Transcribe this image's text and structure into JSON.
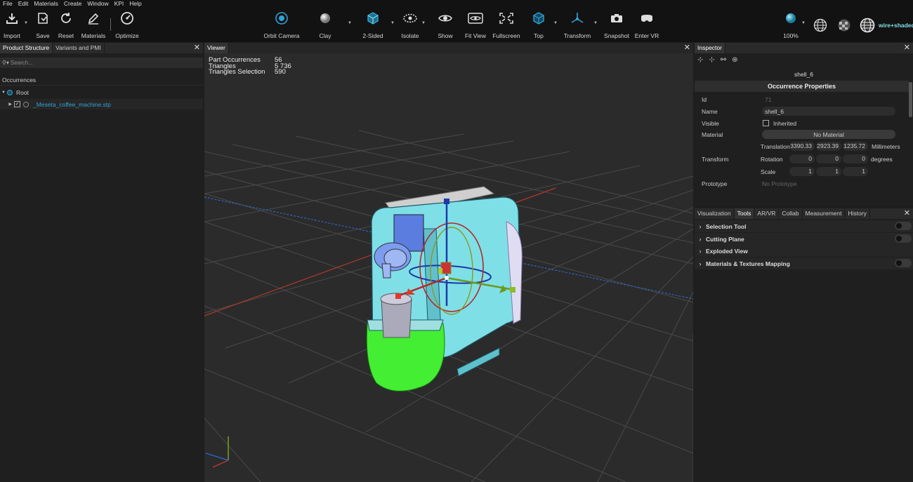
{
  "menu": [
    "File",
    "Edit",
    "Materials",
    "Create",
    "Window",
    "KPI",
    "Help"
  ],
  "toolbar": {
    "import": "Import",
    "save": "Save",
    "reset": "Reset",
    "materials": "Materials",
    "optimize": "Optimize",
    "orbit": "Orbit Camera",
    "clay": "Clay",
    "two_sided": "2-Sided",
    "isolate": "Isolate",
    "show": "Show",
    "fit_view": "Fit View",
    "fullscreen": "Fullscreen",
    "top": "Top",
    "transform": "Transform",
    "snapshot": "Snapshot",
    "enter_vr": "Enter VR",
    "zoom": "100%",
    "render_mode": "wire+shaded"
  },
  "left": {
    "tabs": [
      "Product Structure",
      "Variants and PMI"
    ],
    "search_placeholder": "Search...",
    "occurrences_header": "Occurrences",
    "tree": [
      {
        "label": "Root"
      },
      {
        "label": "_Meseta_coffee_machine.stp"
      }
    ]
  },
  "viewer": {
    "tab": "Viewer",
    "stats": [
      {
        "k": "Part Occurrences",
        "v": "56"
      },
      {
        "k": "Triangles",
        "v": "5 736"
      },
      {
        "k": "Triangles Selection",
        "v": "590"
      }
    ]
  },
  "inspector": {
    "tab": "Inspector",
    "selected": "shell_6",
    "section": "Occurrence Properties",
    "id_label": "Id",
    "id_value": "71",
    "name_label": "Name",
    "name_value": "shell_6",
    "visible_label": "Visible",
    "inherited": "Inherited",
    "material_label": "Material",
    "material_value": "No Material",
    "transform_label": "Transform",
    "translation_label": "Translation",
    "translation": [
      "3390.33",
      "2923.39",
      "1235.72"
    ],
    "translation_unit": "Millimeters",
    "rotation_label": "Rotation",
    "rotation": [
      "0",
      "0",
      "0"
    ],
    "rotation_unit": "degrees",
    "scale_label": "Scale",
    "scale": [
      "1",
      "1",
      "1"
    ],
    "prototype_label": "Prototype",
    "prototype_value": "No Prototype"
  },
  "tools": {
    "tabs": [
      "Visualization",
      "Tools",
      "AR/VR",
      "Collab",
      "Measurement",
      "History"
    ],
    "items": [
      {
        "label": "Selection Tool",
        "toggle": true
      },
      {
        "label": "Cutting Plane",
        "toggle": true
      },
      {
        "label": "Exploded View",
        "toggle": false
      },
      {
        "label": "Materials & Textures Mapping",
        "toggle": true
      }
    ]
  },
  "colors": {
    "accent": "#2fa3d6",
    "body": "#7fdfe6",
    "tray": "#44ee33",
    "axis_x": "#e03a2a",
    "axis_y": "#8cbd2a",
    "axis_z": "#2a6bd6"
  }
}
